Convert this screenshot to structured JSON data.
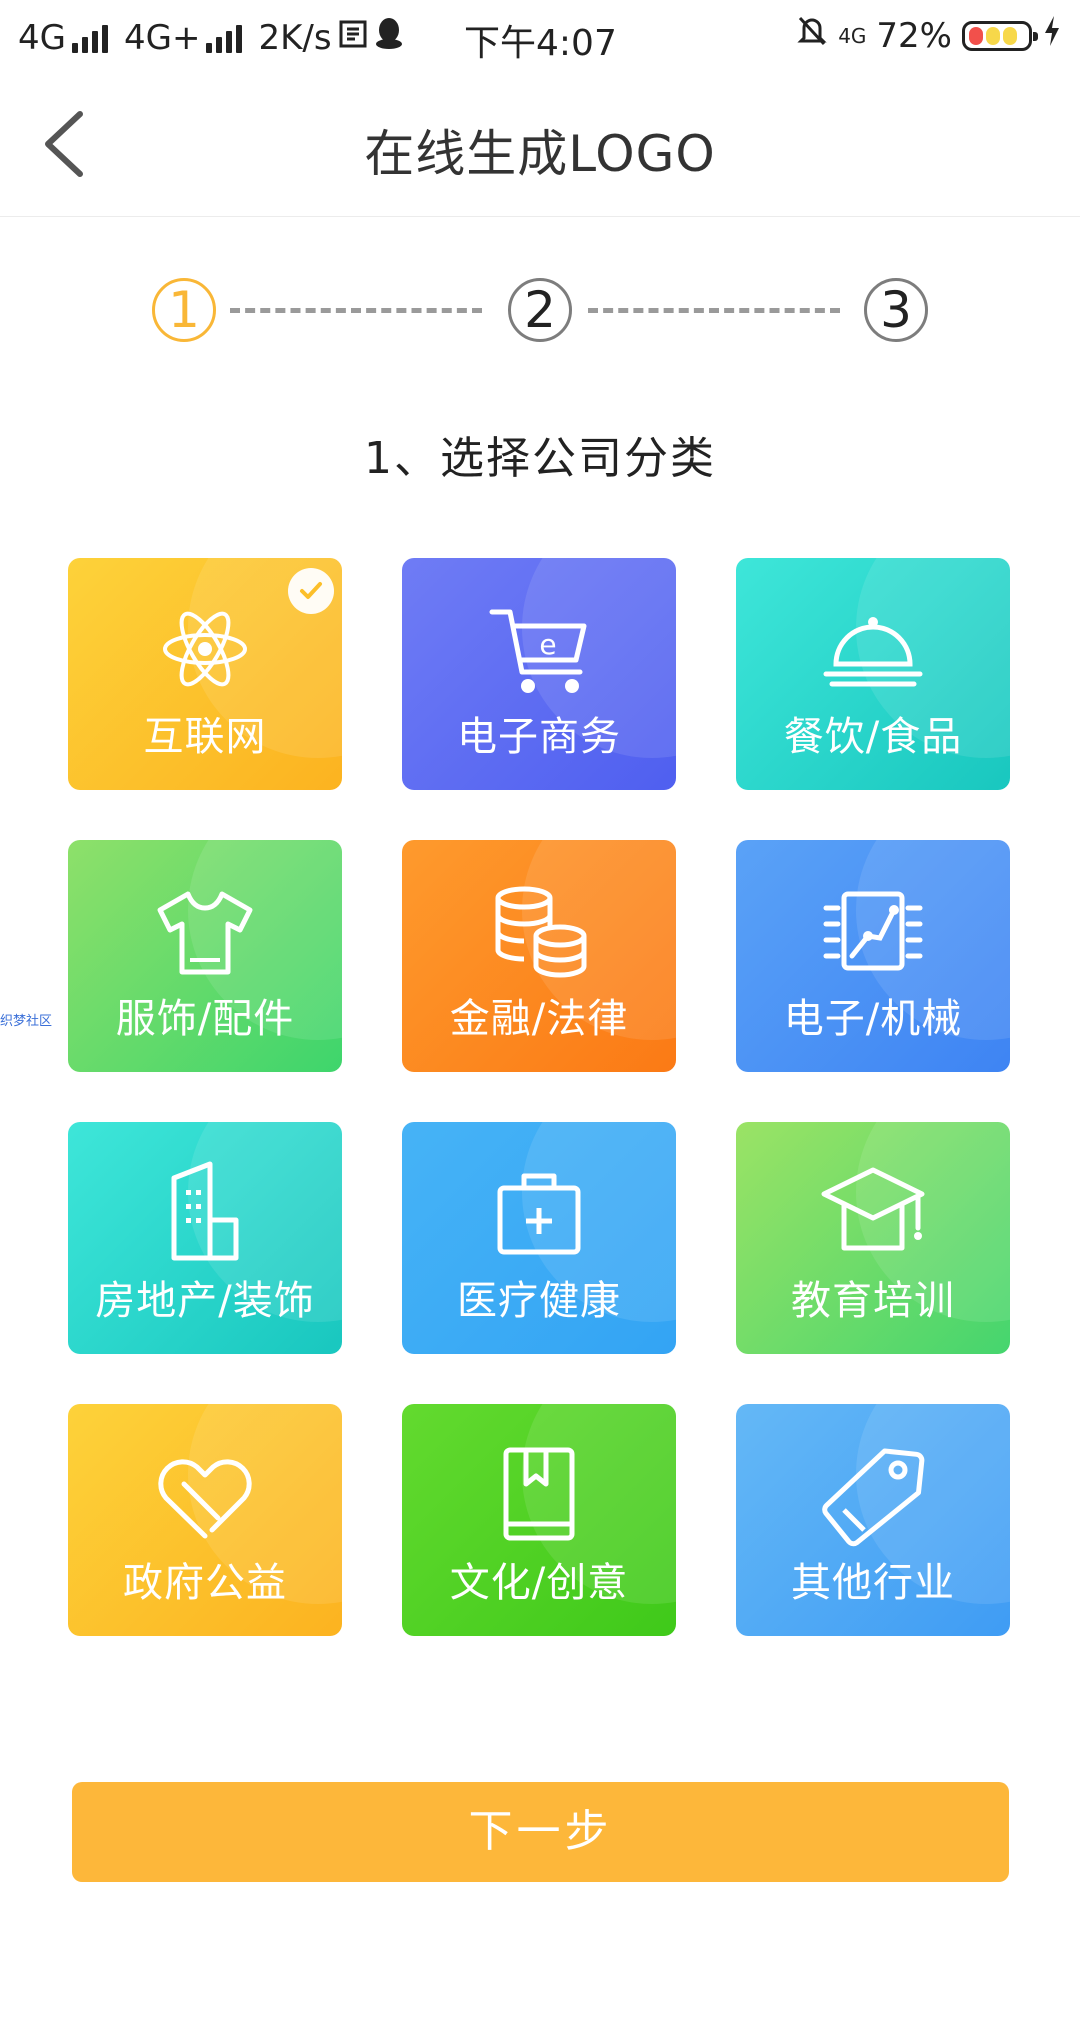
{
  "status_bar": {
    "net1": "4G",
    "net2": "4G+",
    "speed": "2K/s",
    "time": "下午4:07",
    "net3": "4G",
    "battery": "72%"
  },
  "nav": {
    "title": "在线生成LOGO"
  },
  "stepper": {
    "steps": [
      "1",
      "2",
      "3"
    ],
    "active_step": 1
  },
  "section_title": "1、选择公司分类",
  "categories": [
    {
      "label": "互联网",
      "icon": "atom-icon",
      "selected": true
    },
    {
      "label": "电子商务",
      "icon": "shopping-cart-icon",
      "selected": false
    },
    {
      "label": "餐饮/食品",
      "icon": "food-cloche-icon",
      "selected": false
    },
    {
      "label": "服饰/配件",
      "icon": "tshirt-icon",
      "selected": false
    },
    {
      "label": "金融/法律",
      "icon": "coins-icon",
      "selected": false
    },
    {
      "label": "电子/机械",
      "icon": "circuit-chip-icon",
      "selected": false
    },
    {
      "label": "房地产/装饰",
      "icon": "building-icon",
      "selected": false
    },
    {
      "label": "医疗健康",
      "icon": "medical-kit-icon",
      "selected": false
    },
    {
      "label": "教育培训",
      "icon": "graduation-cap-icon",
      "selected": false
    },
    {
      "label": "政府公益",
      "icon": "heart-icon",
      "selected": false
    },
    {
      "label": "文化/创意",
      "icon": "book-icon",
      "selected": false
    },
    {
      "label": "其他行业",
      "icon": "tag-icon",
      "selected": false
    }
  ],
  "side_watermark": "织梦社区",
  "next_button": "下一步",
  "colors": {
    "accent": "#fdb73a",
    "step_active": "#f9b737"
  }
}
